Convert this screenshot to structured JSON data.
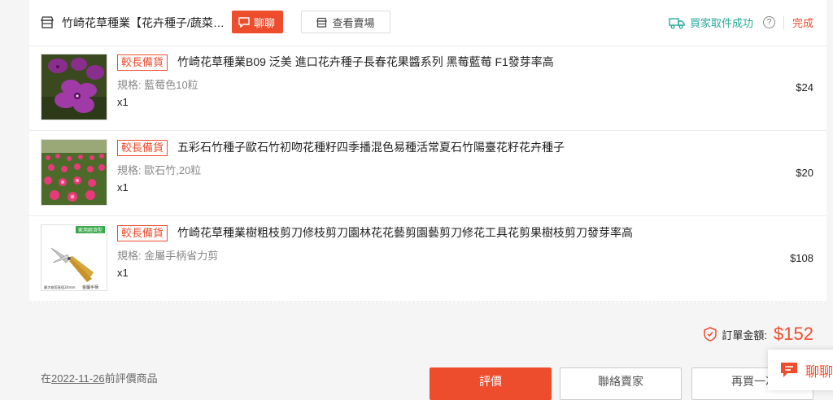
{
  "shop": {
    "name": "竹崎花草種業【花卉種子/蔬菜種子】",
    "chat_label": "聊聊",
    "view_shop_label": "查看賣場"
  },
  "status": {
    "text": "買家取件成功",
    "help": "?",
    "done": "完成"
  },
  "items": [
    {
      "badge": "較長備貨",
      "title": "竹崎花草種業B09 泛美 進口花卉種子長春花果醬系列 黑莓藍莓 F1發芽率高",
      "variant": "規格: 藍莓色10粒",
      "qty": "x1",
      "price": "$24"
    },
    {
      "badge": "較長備貨",
      "title": "五彩石竹種子歐石竹初吻花種籽四季播混色易種活常夏石竹陽臺花籽花卉種子",
      "variant": "規格: 歐石竹,20粒",
      "qty": "x1",
      "price": "$20"
    },
    {
      "badge": "較長備貨",
      "title": "竹崎花草種業樹粗枝剪刀修枝剪刀園林花花藝剪園藝剪刀修花工具花剪果樹枝剪刀發芽率高",
      "variant": "規格: 金屬手柄省力剪",
      "qty": "x1",
      "price": "$108",
      "image_text": {
        "tag": "家用經濟型",
        "caption": "最大修剪直徑20mm",
        "handle": "金屬手柄"
      }
    }
  ],
  "total": {
    "label": "訂單金額:",
    "value": "$152"
  },
  "review_note": {
    "prefix": "在",
    "date": "2022-11-26",
    "suffix": "前評價商品"
  },
  "actions": {
    "rate": "評價",
    "contact": "聯絡賣家",
    "rebuy": "再買一次"
  },
  "chat_float": {
    "label": "聊聊"
  },
  "colors": {
    "accent": "#ee4d2d",
    "status_green": "#26aa99"
  }
}
